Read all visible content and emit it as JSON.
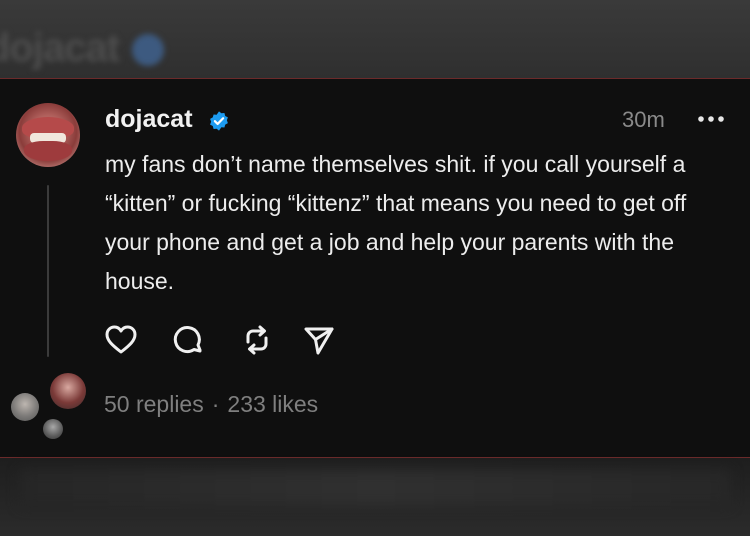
{
  "background": {
    "top_name_blurred": "dojacat"
  },
  "post": {
    "username": "dojacat",
    "timestamp": "30m",
    "text": "my fans don’t name themselves shit. if you call yourself a “kitten” or fucking “kittenz” that means you need to get off your phone and get a job and help your parents with the house.",
    "stats": {
      "replies": "50 replies",
      "separator": "·",
      "likes": "233 likes"
    }
  },
  "icons": {
    "verified": "verified-badge-icon",
    "more": "more-dots-icon",
    "like": "heart-icon",
    "reply": "comment-icon",
    "repost": "repost-icon",
    "share": "send-icon"
  },
  "colors": {
    "card_background": "#0f0f0f",
    "text_primary": "#ededed",
    "text_secondary": "#7f7f7f",
    "verified_blue": "#1d9bf0",
    "card_border": "#6b2a2a"
  }
}
